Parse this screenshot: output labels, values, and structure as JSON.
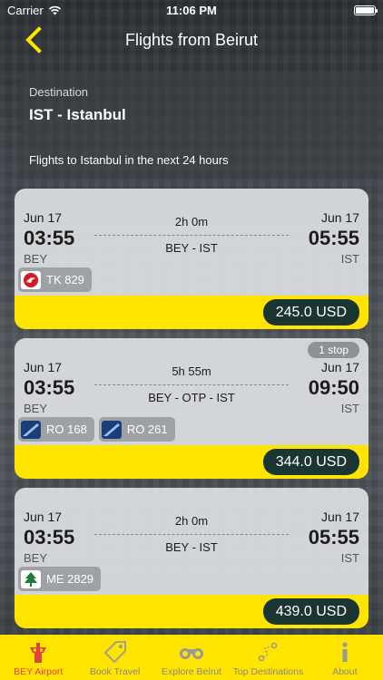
{
  "status": {
    "carrier": "Carrier",
    "time": "11:06 PM"
  },
  "nav": {
    "title": "Flights from Beirut"
  },
  "destination": {
    "label": "Destination",
    "value": "IST - Istanbul",
    "subtitle": "Flights to Istanbul in the next 24 hours"
  },
  "flights": [
    {
      "dep_date": "Jun 17",
      "dep_time": "03:55",
      "dep_code": "BEY",
      "arr_date": "Jun 17",
      "arr_time": "05:55",
      "arr_code": "IST",
      "duration": "2h 0m",
      "route": "BEY - IST",
      "stops": null,
      "flights": [
        {
          "number": "TK 829",
          "airline_icon": "turkish-airlines-logo"
        }
      ],
      "price": "245.0 USD"
    },
    {
      "dep_date": "Jun 17",
      "dep_time": "03:55",
      "dep_code": "BEY",
      "arr_date": "Jun 17",
      "arr_time": "09:50",
      "arr_code": "IST",
      "duration": "5h 55m",
      "route": "BEY - OTP - IST",
      "stops": "1 stop",
      "flights": [
        {
          "number": "RO 168",
          "airline_icon": "tarom-logo"
        },
        {
          "number": "RO 261",
          "airline_icon": "tarom-logo"
        }
      ],
      "price": "344.0 USD"
    },
    {
      "dep_date": "Jun 17",
      "dep_time": "03:55",
      "dep_code": "BEY",
      "arr_date": "Jun 17",
      "arr_time": "05:55",
      "arr_code": "IST",
      "duration": "2h 0m",
      "route": "BEY - IST",
      "stops": null,
      "flights": [
        {
          "number": "ME 2829",
          "airline_icon": "mea-cedar-logo"
        }
      ],
      "price": "439.0 USD"
    }
  ],
  "tabs": [
    {
      "label": "BEY Airport",
      "icon": "control-tower-icon",
      "active": true
    },
    {
      "label": "Book Travel",
      "icon": "tag-icon",
      "active": false
    },
    {
      "label": "Explore Beirut",
      "icon": "binoculars-icon",
      "active": false
    },
    {
      "label": "Top Destinations",
      "icon": "route-icon",
      "active": false
    },
    {
      "label": "About",
      "icon": "info-icon",
      "active": false
    }
  ],
  "colors": {
    "accent_yellow": "#ffe400",
    "price_bg": "#1b3533",
    "active_tab": "#e0443c"
  }
}
